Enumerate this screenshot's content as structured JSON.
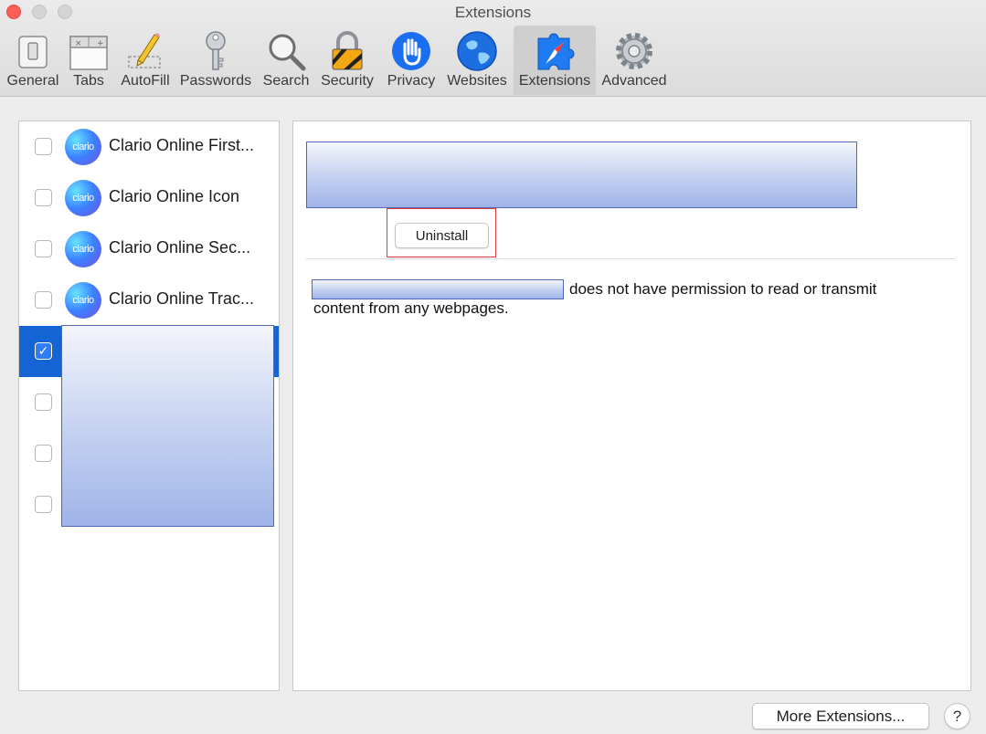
{
  "window": {
    "title": "Extensions"
  },
  "toolbar": {
    "items": [
      {
        "label": "General",
        "icon": "switch-icon"
      },
      {
        "label": "Tabs",
        "icon": "tabs-icon"
      },
      {
        "label": "AutoFill",
        "icon": "pencil-icon"
      },
      {
        "label": "Passwords",
        "icon": "key-icon"
      },
      {
        "label": "Search",
        "icon": "magnifier-icon"
      },
      {
        "label": "Security",
        "icon": "lock-icon"
      },
      {
        "label": "Privacy",
        "icon": "hand-icon"
      },
      {
        "label": "Websites",
        "icon": "globe-icon"
      },
      {
        "label": "Extensions",
        "icon": "puzzle-compass-icon",
        "selected": true
      },
      {
        "label": "Advanced",
        "icon": "gear-icon"
      }
    ]
  },
  "extensions": {
    "items": [
      {
        "label": "Clario Online First...",
        "avatar_text": "clario",
        "checked": false
      },
      {
        "label": "Clario Online Icon",
        "avatar_text": "clario",
        "checked": false
      },
      {
        "label": "Clario Online Sec...",
        "avatar_text": "clario",
        "checked": false
      },
      {
        "label": "Clario Online Trac...",
        "avatar_text": "clario",
        "checked": false
      },
      {
        "label": "",
        "checked": true,
        "selected": true
      },
      {
        "label": "",
        "checked": false
      },
      {
        "label": "",
        "checked": false
      },
      {
        "label": "",
        "checked": false
      }
    ],
    "checkmark": "✓"
  },
  "detail": {
    "uninstall_label": "Uninstall",
    "permission_line1": "does not have permission to read or transmit",
    "permission_line2": "content from any webpages."
  },
  "footer": {
    "more_label": "More Extensions...",
    "help_label": "?"
  },
  "colors": {
    "selection": "#1464d6",
    "highlight_box": "#e23a3a",
    "close": "#fc5f57"
  }
}
